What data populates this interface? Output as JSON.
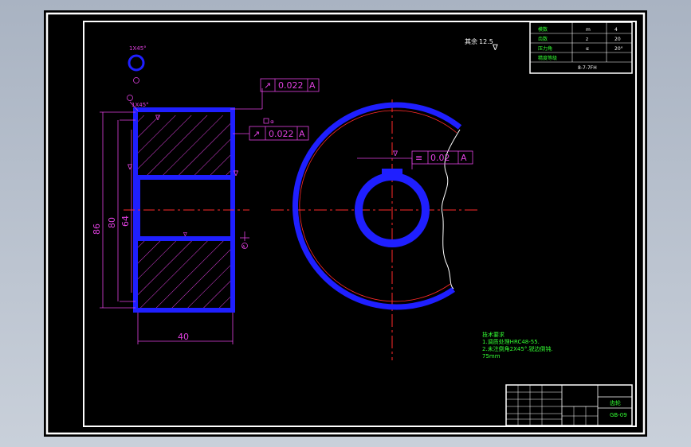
{
  "drawing": {
    "dims": {
      "outer": "86",
      "mid": "80",
      "inner": "64",
      "width": "40"
    },
    "tolerance_top": {
      "symbol": "↗",
      "value": "0.022",
      "datum": "A"
    },
    "tolerance_mid": {
      "symbol": "↗",
      "value": "0.022",
      "datum": "A"
    },
    "tolerance_key": {
      "symbol": "≡",
      "value": "0.02",
      "datum": "A"
    },
    "chamfer_top": "1X45°",
    "chamfer_side": "1X45°",
    "datum_label": "A",
    "roughness_note": "其余",
    "roughness_value": "12.5",
    "notes": [
      "技术要求",
      "1.调质处理HRC48-55.",
      "2.未注倒角2X45°.锐边倒钝.",
      "75mm"
    ],
    "param_table": [
      [
        "模数",
        "m",
        "4"
      ],
      [
        "齿数",
        "z",
        "20"
      ],
      [
        "压力角",
        "α",
        "20°"
      ],
      [
        "精度等级",
        "",
        "8-7-7FH"
      ]
    ],
    "title_block": {
      "name": "齿轮",
      "code": "GB-09"
    }
  },
  "colors": {
    "background": "#000000",
    "part_outline": "#1f1fff",
    "dimension": "#e040e0",
    "centerline": "#ff2a2a",
    "frame": "#ffffff",
    "note": "#33ff33"
  }
}
